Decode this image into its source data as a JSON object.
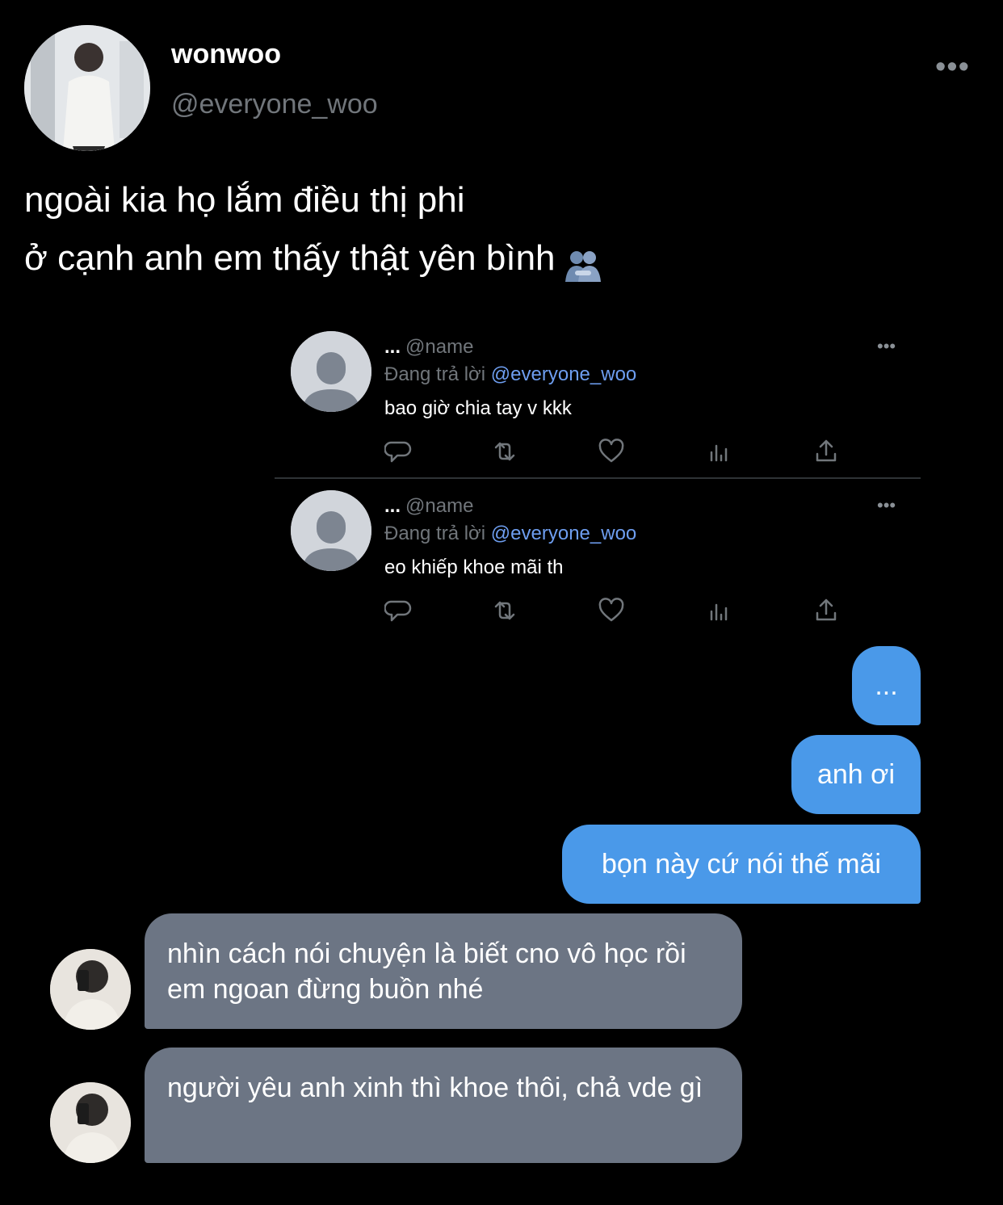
{
  "author": {
    "display_name": "wonwoo",
    "handle": "@everyone_woo",
    "avatar_icon": "profile-photo",
    "more_icon": "more-horizontal-icon",
    "more_glyph": "•••"
  },
  "tweet": {
    "line1": "ngoài kia họ lắm điều thị phi",
    "line2": "ở cạnh anh em thấy thật yên bình",
    "emoji_icon": "people-hugging-emoji"
  },
  "replies": [
    {
      "name": "...",
      "handle": "@name",
      "replying_prefix": "Đang trả lời",
      "replying_to": "@everyone_woo",
      "text": "bao giờ chia tay v kkk",
      "more_glyph": "•••"
    },
    {
      "name": "...",
      "handle": "@name",
      "replying_prefix": "Đang trả lời",
      "replying_to": "@everyone_woo",
      "text": "eo khiếp khoe mãi th",
      "more_glyph": "•••"
    }
  ],
  "actions": [
    "reply-icon",
    "retweet-icon",
    "like-icon",
    "analytics-icon",
    "share-icon"
  ],
  "chat": {
    "sent": [
      "...",
      "anh ơi",
      "bọn này cứ nói thế mãi"
    ],
    "received": [
      "nhìn cách nói chuyện là biết cno vô học rồi em ngoan đừng buồn nhé",
      "người yêu anh xinh thì khoe thôi, chả vde gì"
    ]
  },
  "colors": {
    "background": "#000000",
    "sent_bubble": "#4a99e9",
    "received_bubble": "#6c7584",
    "mention": "#6e9ef0",
    "muted": "#71767b"
  }
}
